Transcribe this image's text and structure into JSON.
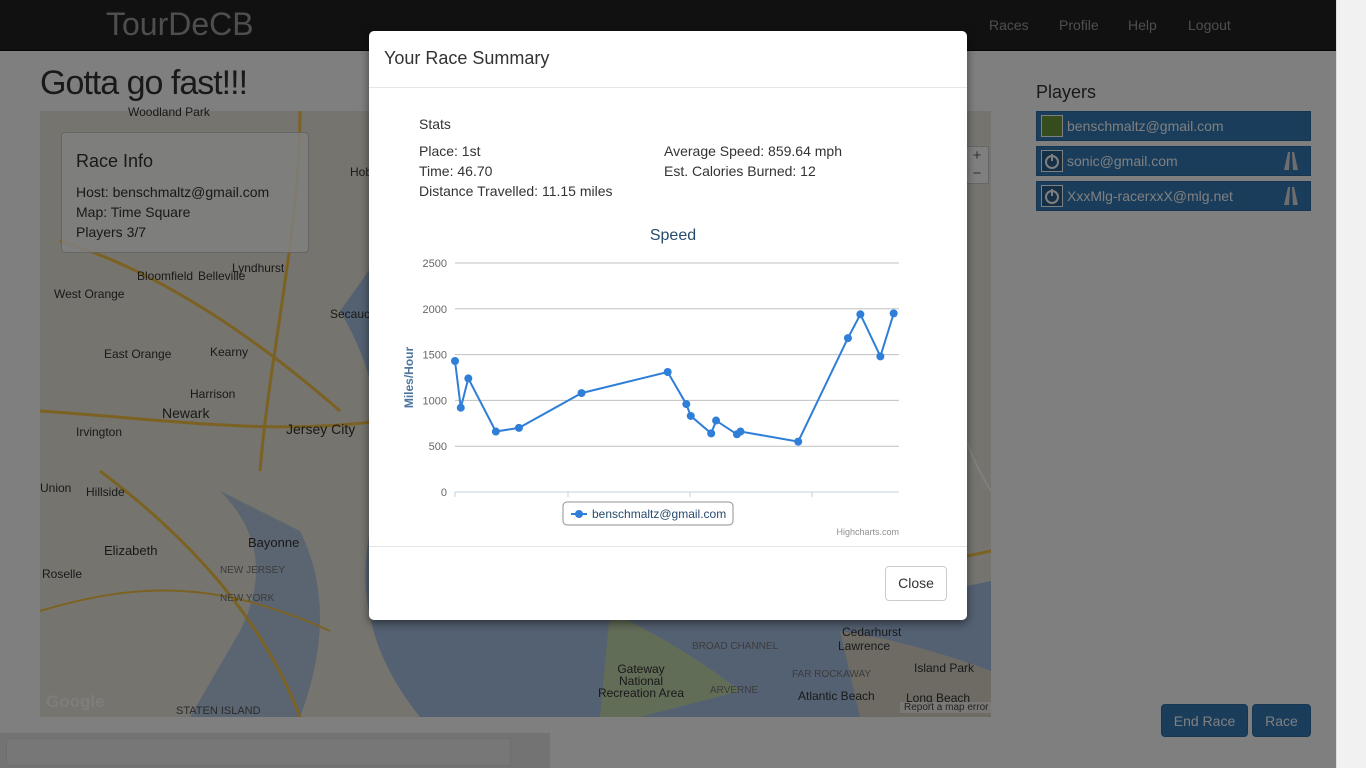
{
  "navbar": {
    "brand": "TourDeCB",
    "links": [
      "Races",
      "Profile",
      "Help",
      "Logout"
    ]
  },
  "page": {
    "title": "Gotta go fast!!!"
  },
  "race_info": {
    "heading": "Race Info",
    "host": "Host: benschmaltz@gmail.com",
    "map": "Map: Time Square",
    "players": "Players 3/7"
  },
  "map": {
    "zoom_in": "+",
    "zoom_out": "−",
    "credit": "Report a map error",
    "logo": "Google",
    "labels": [
      "Woodland Park",
      "West Orange",
      "Belleville",
      "Lyndhurst",
      "East Orange",
      "Kearny",
      "Newark",
      "Irvington",
      "Harrison",
      "Jersey City",
      "Union",
      "Hillside",
      "Elizabeth",
      "Bayonne",
      "Roselle",
      "NEW JERSEY",
      "NEW YORK",
      "STATEN ISLAND",
      "Bloomfield",
      "Hoboken",
      "Gateway National Recreation Area",
      "Cedarhurst",
      "Lawrence",
      "Island Park",
      "Atlantic Beach",
      "Long Beach",
      "FAR ROCKAWAY",
      "ARVERNE",
      "BROAD CHANNEL",
      "Secaucus"
    ]
  },
  "players": {
    "heading": "Players",
    "list": [
      {
        "email": "benschmaltz@gmail.com",
        "icon": "avatar-icon",
        "status": ""
      },
      {
        "email": "sonic@gmail.com",
        "icon": "power-icon",
        "status": "road-icon"
      },
      {
        "email": "XxxMlg-racerxxX@mlg.net",
        "icon": "power-icon",
        "status": "road-icon"
      }
    ]
  },
  "buttons": {
    "end_race": "End Race",
    "race": "Race"
  },
  "modal": {
    "title": "Your Race Summary",
    "stats_heading": "Stats",
    "place": "Place: 1st",
    "time": "Time: 46.70",
    "distance": "Distance Travelled: 11.15 miles",
    "avg_speed": "Average Speed: 859.64 mph",
    "calories": "Est. Calories Burned: 12",
    "close": "Close"
  },
  "chart_data": {
    "type": "line",
    "title": "Speed",
    "ylabel": "Miles/Hour",
    "xlabel": "",
    "ylim": [
      0,
      2500
    ],
    "yticks": [
      0,
      500,
      1000,
      1500,
      2000,
      2500
    ],
    "credit": "Highcharts.com",
    "legend": "bottom-center",
    "grid": true,
    "color": "#2f7ed8",
    "series": [
      {
        "name": "benschmaltz@gmail.com",
        "x": [
          0,
          1.3,
          3,
          9.2,
          14.4,
          28.5,
          47.9,
          52.1,
          53.1,
          57.7,
          58.8,
          63.5,
          64.3,
          77.3,
          88.5,
          91.3,
          95.8,
          98.8
        ],
        "values": [
          1430,
          920,
          1240,
          660,
          700,
          1080,
          1310,
          960,
          830,
          640,
          780,
          630,
          660,
          550,
          1680,
          1940,
          1480,
          1950
        ]
      }
    ]
  }
}
